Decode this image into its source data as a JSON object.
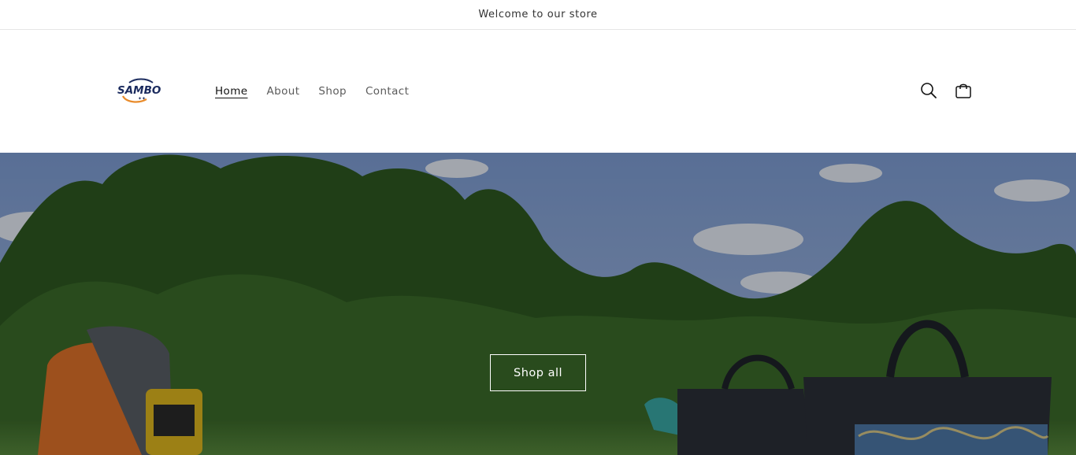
{
  "announcement": {
    "text": "Welcome to our store"
  },
  "header": {
    "logo": {
      "text": "SAMBO",
      "alt_icon": "brand-swoosh-logo"
    },
    "nav": [
      {
        "label": "Home",
        "active": true
      },
      {
        "label": "About",
        "active": false
      },
      {
        "label": "Shop",
        "active": false
      },
      {
        "label": "Contact",
        "active": false
      }
    ],
    "icons": {
      "search": "search-icon",
      "cart": "cart-icon"
    }
  },
  "hero": {
    "button_label": "Shop all",
    "image": "outdoor-trees-with-backpack-and-garden-tool-bags"
  },
  "colors": {
    "text": "#121212",
    "nav_inactive": "#5b5b5b",
    "logo_navy": "#1b2b5e",
    "logo_orange": "#e98b2a",
    "sky": "#7e9bd1",
    "foliage": "#2f5a22"
  }
}
